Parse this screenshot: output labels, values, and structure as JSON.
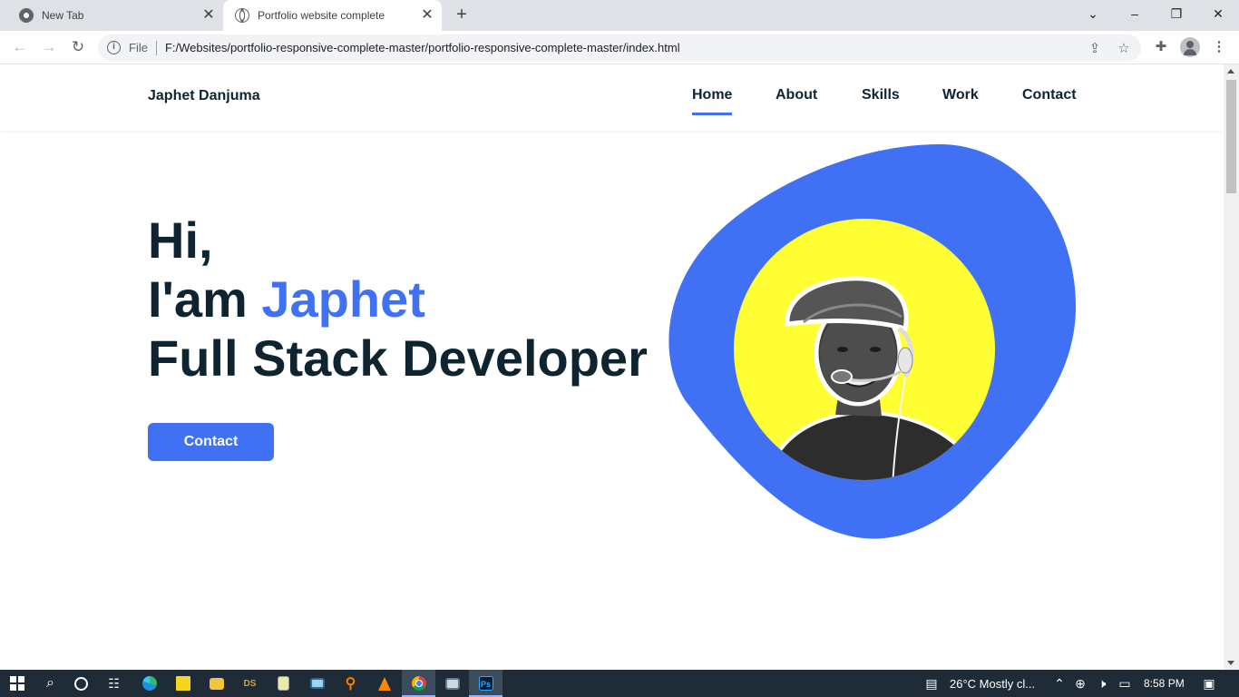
{
  "browser": {
    "tabs": [
      {
        "title": "New Tab",
        "active": false
      },
      {
        "title": "Portfolio website complete",
        "active": true
      }
    ],
    "new_tab_symbol": "+",
    "close_symbol": "✕",
    "address": {
      "scheme": "File",
      "url": "F:/Websites/portfolio-responsive-complete-master/portfolio-responsive-complete-master/index.html"
    },
    "icons": [
      "back-icon",
      "forward-icon",
      "reload-icon",
      "info-icon",
      "share-icon",
      "star-icon",
      "extensions-icon",
      "profile-icon",
      "menu-icon"
    ]
  },
  "site": {
    "logo": "Japhet Danjuma",
    "nav": [
      "Home",
      "About",
      "Skills",
      "Work",
      "Contact"
    ],
    "active_nav": "Home",
    "hero": {
      "line1": "Hi,",
      "line2_prefix": "I'am ",
      "line2_name": "Japhet",
      "line3": "Full Stack Developer",
      "button": "Contact"
    },
    "colors": {
      "accent": "#4070f4",
      "text": "#0e2431",
      "photo_background": "#ffff33"
    }
  },
  "taskbar": {
    "weather": "26°C  Mostly cl...",
    "time": "8:58 PM",
    "apps": [
      "start-icon",
      "search-icon",
      "cortana-icon",
      "task-view-icon",
      "edge-icon",
      "sticky-notes-icon",
      "file-explorer-icon",
      "ds-app-icon",
      "notepad-icon",
      "display-icon",
      "search-app-icon",
      "vlc-icon",
      "chrome-icon",
      "remote-desktop-icon",
      "photoshop-icon"
    ],
    "ds_label": "DS",
    "ps_label": "Ps"
  }
}
